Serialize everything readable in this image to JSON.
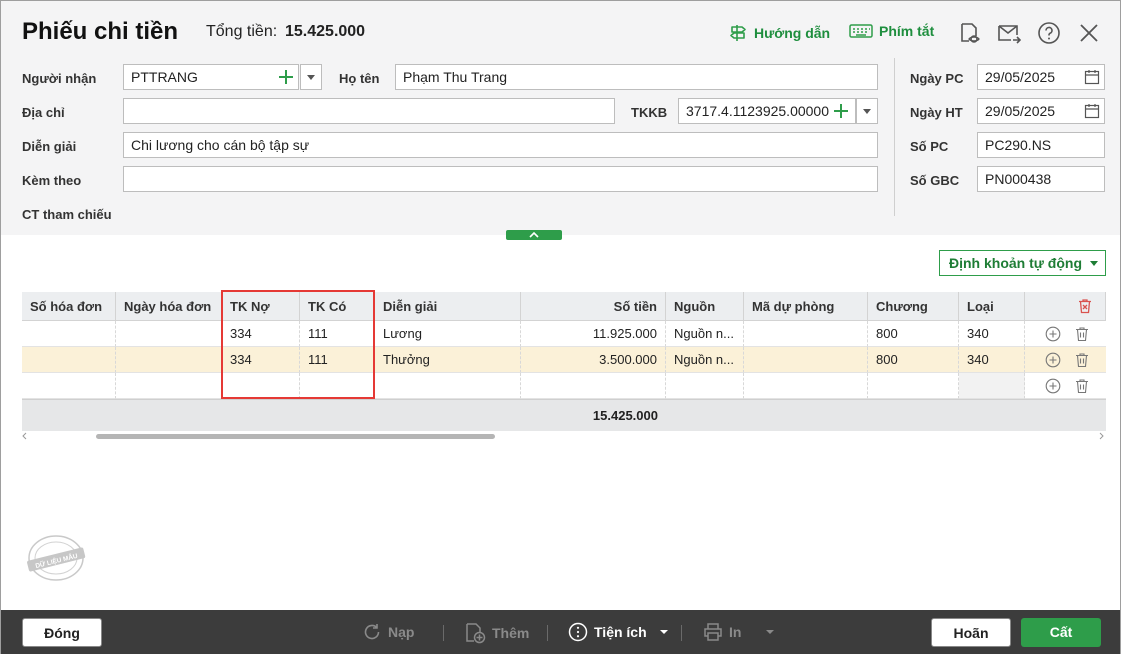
{
  "header": {
    "title": "Phiếu chi tiền",
    "total_label": "Tổng tiền:",
    "total_value": "15.425.000",
    "guide_label": "Hướng dẫn",
    "shortcut_label": "Phím tắt",
    "icons": [
      "preview-icon",
      "send-mail-icon",
      "help-icon",
      "close-icon"
    ]
  },
  "form": {
    "recipient_label": "Người nhận",
    "recipient_value": "PTTRANG",
    "fullname_label": "Họ tên",
    "fullname_value": "Phạm Thu Trang",
    "address_label": "Địa chỉ",
    "address_value": "",
    "bank_account_label": "TKKB",
    "bank_account_value": "3717.4.1123925.00000",
    "description_label": "Diễn giải",
    "description_value": "Chi lương cho cán bộ tập sự",
    "attached_label": "Kèm theo",
    "attached_value": "",
    "reference_label": "CT tham chiếu"
  },
  "right_panel": {
    "voucher_date_label": "Ngày PC",
    "voucher_date_value": "29/05/2025",
    "posting_date_label": "Ngày HT",
    "posting_date_value": "29/05/2025",
    "voucher_no_label": "Số PC",
    "voucher_no_value": "PC290.NS",
    "gbc_no_label": "Số GBC",
    "gbc_no_value": "PN000438"
  },
  "auto_posting_label": "Định khoản tự động",
  "table": {
    "columns": [
      "Số hóa đơn",
      "Ngày hóa đơn",
      "TK Nợ",
      "TK Có",
      "Diễn giải",
      "Số tiền",
      "Nguồn",
      "Mã dự phòng",
      "Chương",
      "Loại"
    ],
    "rows": [
      {
        "invoice_no": "",
        "invoice_date": "",
        "debit": "334",
        "credit": "111",
        "desc": "Lương",
        "amount": "11.925.000",
        "source": "Nguồn n...",
        "reserve": "",
        "chapter": "800",
        "type": "340"
      },
      {
        "invoice_no": "",
        "invoice_date": "",
        "debit": "334",
        "credit": "111",
        "desc": "Thưởng",
        "amount": "3.500.000",
        "source": "Nguồn n...",
        "reserve": "",
        "chapter": "800",
        "type": "340"
      },
      {
        "invoice_no": "",
        "invoice_date": "",
        "debit": "",
        "credit": "",
        "desc": "",
        "amount": "",
        "source": "",
        "reserve": "",
        "chapter": "",
        "type": ""
      }
    ],
    "total": "15.425.000"
  },
  "stamp_text": "DỮ LIỆU MẪU",
  "footer": {
    "close_label": "Đóng",
    "reload_label": "Nạp",
    "add_label": "Thêm",
    "utility_label": "Tiện ích",
    "print_label": "In",
    "cancel_label": "Hoãn",
    "save_label": "Cất"
  },
  "colors": {
    "accent": "#2e9d4a",
    "highlight_row": "#fbf1d8",
    "annotation_box": "#e53935",
    "footer_bar": "#3c3c3c"
  }
}
